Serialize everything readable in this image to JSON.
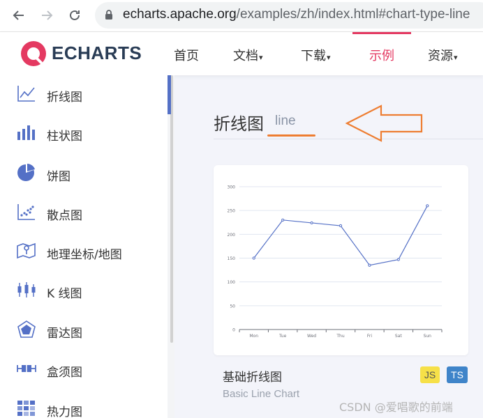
{
  "browser": {
    "url_host": "echarts.apache.org",
    "url_path": "/examples/zh/index.html#chart-type-line"
  },
  "header": {
    "logo_text": "ECHARTS",
    "menu": [
      {
        "label": "首页",
        "has_caret": false
      },
      {
        "label": "文档",
        "has_caret": true
      },
      {
        "label": "下载",
        "has_caret": true
      },
      {
        "label": "示例",
        "has_caret": false,
        "active": true
      },
      {
        "label": "资源",
        "has_caret": true
      }
    ],
    "caret": "▾",
    "accent_color": "#e43961"
  },
  "sidebar": {
    "items": [
      {
        "label": "折线图",
        "icon": "line-chart-icon"
      },
      {
        "label": "柱状图",
        "icon": "bar-chart-icon"
      },
      {
        "label": "饼图",
        "icon": "pie-chart-icon"
      },
      {
        "label": "散点图",
        "icon": "scatter-chart-icon"
      },
      {
        "label": "地理坐标/地图",
        "icon": "map-icon"
      },
      {
        "label": "K 线图",
        "icon": "candlestick-icon"
      },
      {
        "label": "雷达图",
        "icon": "radar-icon"
      },
      {
        "label": "盒须图",
        "icon": "boxplot-icon"
      },
      {
        "label": "热力图",
        "icon": "heatmap-icon"
      }
    ],
    "icon_color": "#5470c6"
  },
  "main": {
    "section_title": "折线图",
    "section_title_en": "line",
    "annotation_color": "#ee7d31",
    "card": {
      "title": "基础折线图",
      "subtitle": "Basic Line Chart",
      "badges": [
        "JS",
        "TS"
      ]
    }
  },
  "watermark": "CSDN @爱唱歌的前端",
  "chart_data": {
    "type": "line",
    "categories": [
      "Mon",
      "Tue",
      "Wed",
      "Thu",
      "Fri",
      "Sat",
      "Sun"
    ],
    "values": [
      150,
      230,
      224,
      218,
      135,
      147,
      260
    ],
    "yticks": [
      0,
      50,
      100,
      150,
      200,
      250,
      300
    ],
    "ylim": [
      0,
      300
    ],
    "grid": true,
    "line_color": "#5470c6"
  }
}
